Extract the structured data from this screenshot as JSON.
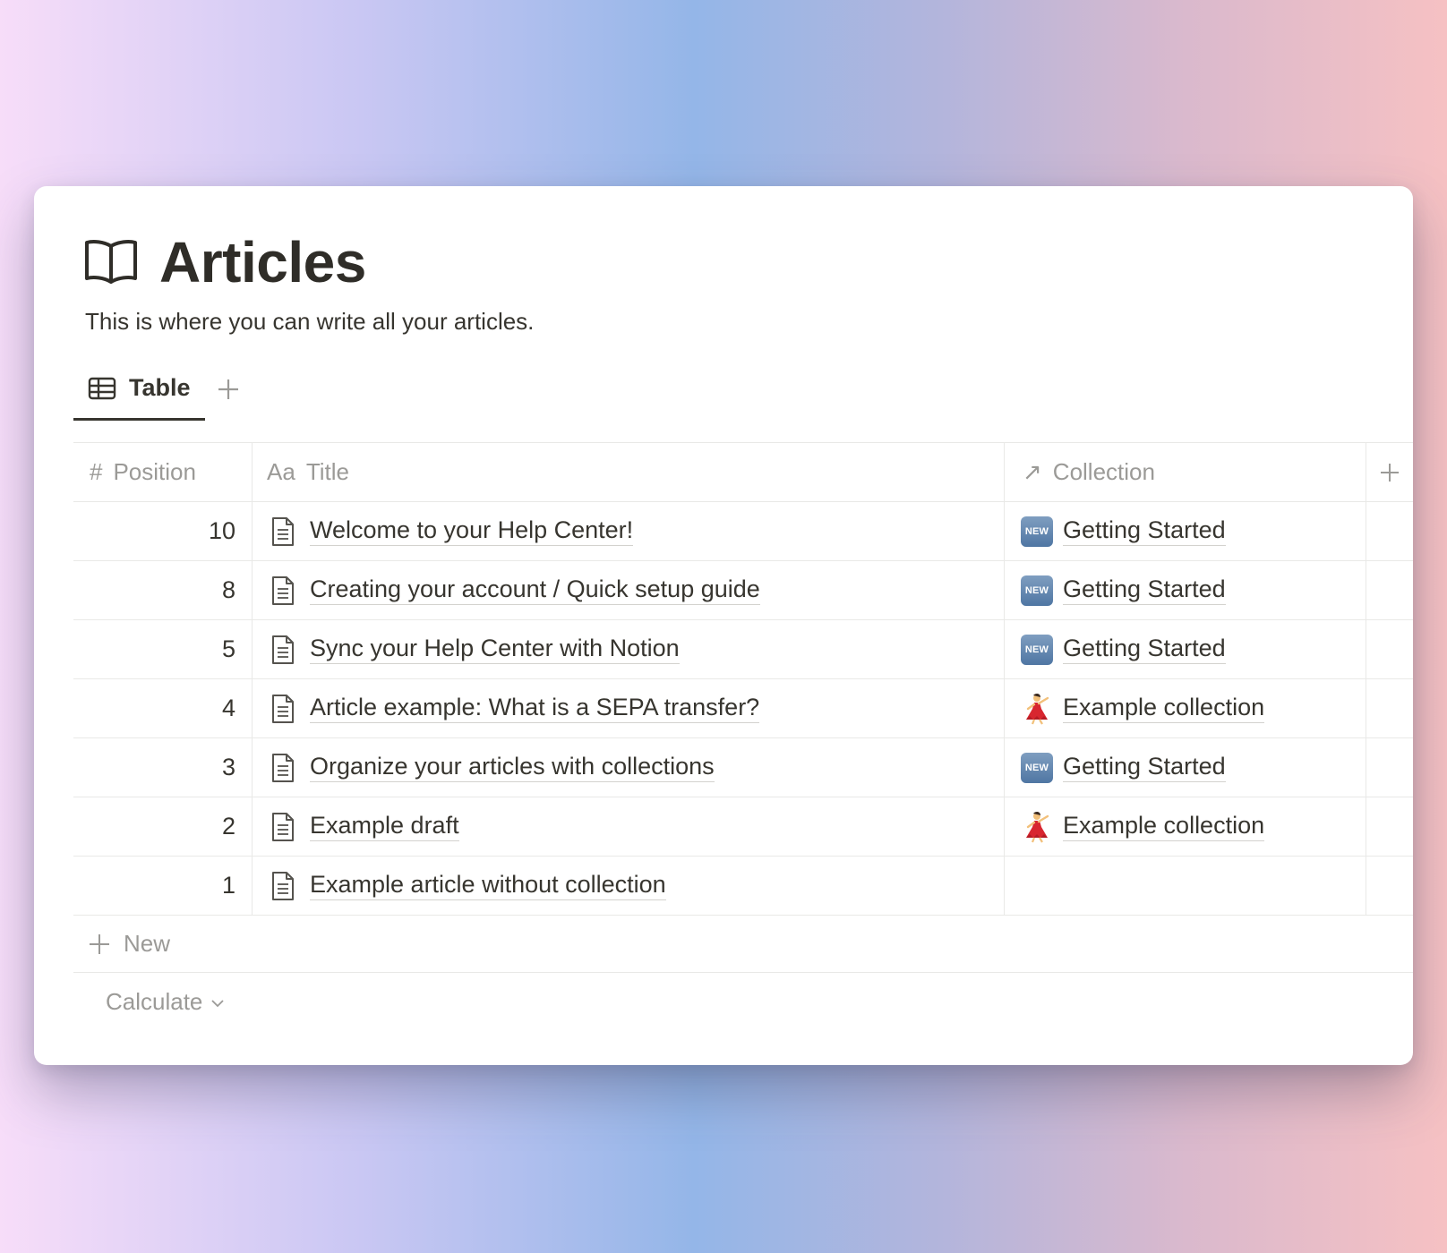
{
  "page": {
    "title": "Articles",
    "icon": "book-open-icon",
    "description": "This is where you can write all your articles."
  },
  "tabs": [
    {
      "label": "Table",
      "icon": "table-icon",
      "active": true
    }
  ],
  "table": {
    "columns": [
      {
        "label": "Position",
        "icon": "#"
      },
      {
        "label": "Title",
        "icon": "Aa"
      },
      {
        "label": "Collection",
        "icon": "↗"
      }
    ],
    "rows": [
      {
        "position": "10",
        "title": "Welcome to your Help Center!",
        "collection": "Getting Started",
        "collection_icon": "new-badge"
      },
      {
        "position": "8",
        "title": "Creating your account / Quick setup guide",
        "collection": "Getting Started",
        "collection_icon": "new-badge"
      },
      {
        "position": "5",
        "title": "Sync your Help Center with Notion",
        "collection": "Getting Started",
        "collection_icon": "new-badge"
      },
      {
        "position": "4",
        "title": "Article example: What is a SEPA transfer?",
        "collection": "Example collection",
        "collection_icon": "dancer"
      },
      {
        "position": "3",
        "title": "Organize your articles with collections",
        "collection": "Getting Started",
        "collection_icon": "new-badge"
      },
      {
        "position": "2",
        "title": "Example draft",
        "collection": "Example collection",
        "collection_icon": "dancer"
      },
      {
        "position": "1",
        "title": "Example article without collection",
        "collection": "",
        "collection_icon": ""
      }
    ],
    "new_label": "New",
    "calculate_label": "Calculate",
    "new_badge_text": "NEW"
  },
  "colors": {
    "text": "#37352f",
    "muted": "#9b9a97",
    "border": "#e9e9e7",
    "badge_blue": "#5b7fa9"
  }
}
